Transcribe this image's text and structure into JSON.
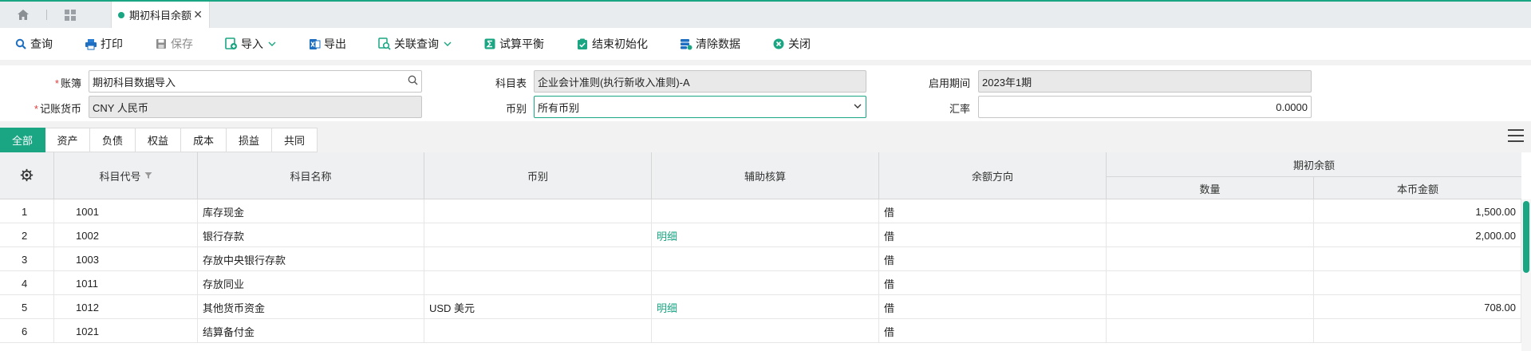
{
  "tabbar": {
    "active_tab_label": "期初科目余额"
  },
  "toolbar": {
    "query": "查询",
    "print": "打印",
    "save": "保存",
    "import": "导入",
    "export": "导出",
    "linked_query": "关联查询",
    "trial_balance": "试算平衡",
    "finish_init": "结束初始化",
    "clear_data": "清除数据",
    "close": "关闭"
  },
  "form": {
    "ledger_label": "账簿",
    "ledger_value": "期初科目数据导入",
    "chart_label": "科目表",
    "chart_value": "企业会计准则(执行新收入准则)-A",
    "period_label": "启用期间",
    "period_value": "2023年1期",
    "currency_label": "记账货币",
    "currency_value": "CNY 人民币",
    "curtype_label": "币别",
    "curtype_value": "所有币别",
    "rate_label": "汇率",
    "rate_value": "0.0000"
  },
  "categories": [
    "全部",
    "资产",
    "负债",
    "权益",
    "成本",
    "损益",
    "共同"
  ],
  "grid": {
    "headers": {
      "code": "科目代号",
      "name": "科目名称",
      "currency": "币别",
      "aux": "辅助核算",
      "direction": "余额方向",
      "opening": "期初余额",
      "qty": "数量",
      "amount": "本币金额"
    },
    "rows": [
      {
        "no": "1",
        "code": "1001",
        "name": "库存现金",
        "currency": "",
        "aux": "",
        "dir": "借",
        "qty": "",
        "amount": "1,500.00"
      },
      {
        "no": "2",
        "code": "1002",
        "name": "银行存款",
        "currency": "",
        "aux": "明细",
        "dir": "借",
        "qty": "",
        "amount": "2,000.00"
      },
      {
        "no": "3",
        "code": "1003",
        "name": "存放中央银行存款",
        "currency": "",
        "aux": "",
        "dir": "借",
        "qty": "",
        "amount": ""
      },
      {
        "no": "4",
        "code": "1011",
        "name": "存放同业",
        "currency": "",
        "aux": "",
        "dir": "借",
        "qty": "",
        "amount": ""
      },
      {
        "no": "5",
        "code": "1012",
        "name": "其他货币资金",
        "currency": "USD 美元",
        "aux": "明细",
        "dir": "借",
        "qty": "",
        "amount": "708.00"
      },
      {
        "no": "6",
        "code": "1021",
        "name": "结算备付金",
        "currency": "",
        "aux": "",
        "dir": "借",
        "qty": "",
        "amount": ""
      }
    ]
  }
}
